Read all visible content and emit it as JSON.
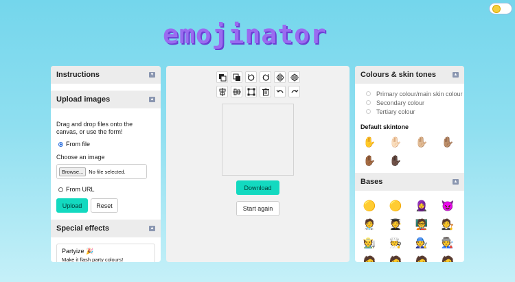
{
  "app": {
    "title": "emojinator"
  },
  "theme_toggle": {
    "state": "light"
  },
  "left_panel": {
    "instructions": {
      "title": "Instructions",
      "collapsed": true
    },
    "upload": {
      "title": "Upload images",
      "collapsed": false,
      "description": "Drag and drop files onto the canvas, or use the form!",
      "from_file_label": "From file",
      "choose_label": "Choose an image",
      "browse_label": "Browse...",
      "no_file_label": "No file selected.",
      "from_url_label": "From URL",
      "upload_label": "Upload",
      "reset_label": "Reset"
    },
    "effects": {
      "title": "Special effects",
      "collapsed": false,
      "items": [
        {
          "name": "Partyize 🎉",
          "desc": "Make it flash party colours!"
        }
      ]
    }
  },
  "center_panel": {
    "toolbar_icons": [
      "bring-forward-icon",
      "send-backward-icon",
      "rotate-left-icon",
      "rotate-right-icon",
      "flip-horizontal-icon",
      "flip-vertical-icon",
      "align-horizontal-icon",
      "align-vertical-icon",
      "resize-icon",
      "delete-icon",
      "undo-icon",
      "redo-icon"
    ],
    "download_label": "Download",
    "start_again_label": "Start again"
  },
  "right_panel": {
    "colours": {
      "title": "Colours & skin tones",
      "options": [
        "Primary colour/main skin colour",
        "Secondary colour",
        "Tertiary colour"
      ]
    },
    "default_skintone": {
      "title": "Default skintone",
      "emojis": [
        "✋",
        "✋🏻",
        "✋🏼",
        "✋🏽",
        "✋🏾",
        "✋🏿"
      ]
    },
    "bases": {
      "title": "Bases",
      "emojis": [
        "🟡",
        "🟡",
        "🧕",
        "😈",
        "🧑‍⚕️",
        "🧑‍🎓",
        "🧑‍🏫",
        "🧑‍⚖️",
        "🧑‍🌾",
        "🧑‍🍳",
        "🧑‍🔧",
        "🧑‍🏭",
        "🧑",
        "🧑",
        "🧑",
        "🧑"
      ]
    }
  },
  "colors": {
    "accent": "#13d9c0",
    "logo": "#9a6bf0",
    "background": "#74d6ec"
  }
}
